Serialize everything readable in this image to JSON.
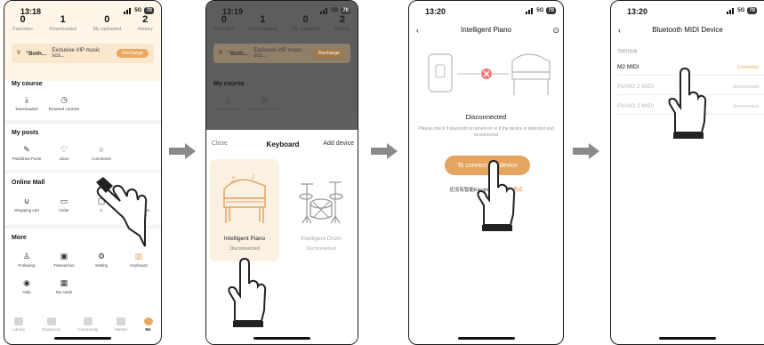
{
  "colors": {
    "accent": "#e3a55f",
    "connected": "#e9a861",
    "arrow": "#8a8a8a"
  },
  "panel1": {
    "time": "13:18",
    "signal": "5G",
    "battery": "70",
    "stats": [
      {
        "n": "0",
        "l": "Favorites"
      },
      {
        "n": "1",
        "l": "Downloaded"
      },
      {
        "n": "0",
        "l": "My uploaded"
      },
      {
        "n": "2",
        "l": "History"
      }
    ],
    "vip": {
      "title": "\"Both...",
      "desc": "Exclusive VIP music sco...",
      "button": "Recharge"
    },
    "my_course": {
      "title": "My course",
      "items": [
        "Downloaded",
        "Browsed courses"
      ]
    },
    "my_posts": {
      "title": "My posts",
      "items": [
        "Published Posts",
        "Likes",
        "Comments"
      ]
    },
    "online_mall": {
      "title": "Online Mall",
      "items": [
        "Shopping cart",
        "Order",
        "C",
        "Redemption vouchers"
      ]
    },
    "more": {
      "title": "More",
      "items": [
        "Following",
        "Transaction",
        "Setting",
        "Keyboard"
      ],
      "items2": [
        "Help",
        "My cards"
      ]
    },
    "tabs": [
      "Library",
      "Classroom",
      "Community",
      "Market",
      "Me"
    ]
  },
  "panel2": {
    "time": "13:19",
    "signal": "5G",
    "battery": "70",
    "stats": [
      {
        "n": "0",
        "l": "Favorites"
      },
      {
        "n": "1",
        "l": "Downloaded"
      },
      {
        "n": "0",
        "l": "My uploaded"
      },
      {
        "n": "2",
        "l": "History"
      }
    ],
    "vip": {
      "title": "\"Both...",
      "desc": "Exclusive VIP music sco...",
      "button": "Recharge"
    },
    "my_course": {
      "title": "My course",
      "items": [
        "Downloaded",
        "Browsed courses"
      ]
    },
    "sheet": {
      "close": "Close",
      "title": "Keyboard",
      "add": "Add device"
    },
    "cards": [
      {
        "name": "Intelligent Piano",
        "status": "Disconnected"
      },
      {
        "name": "Intelligent Drum",
        "status": "Disconnected"
      }
    ]
  },
  "panel3": {
    "time": "13:20",
    "signal": "5G",
    "battery": "70",
    "title": "Intelligent Piano",
    "status": "Disconnected",
    "hint": "Please check if bluetooth is turned on or if the device is detected and reconnected",
    "button": "To connect the device",
    "promo_text": "还没有智能Electric Piano?",
    "promo_link": "去购买"
  },
  "panel4": {
    "time": "13:20",
    "signal": "5G",
    "battery": "70",
    "title": "Bluetooth MIDI Device",
    "section": "可配对设备",
    "devices": [
      {
        "name": "M2 MIDI",
        "status": "Connected"
      },
      {
        "name": "PIANO 2 MIDI",
        "status": "Unconnected"
      },
      {
        "name": "PIANO 3 MIDI",
        "status": "Unconnected"
      }
    ]
  }
}
